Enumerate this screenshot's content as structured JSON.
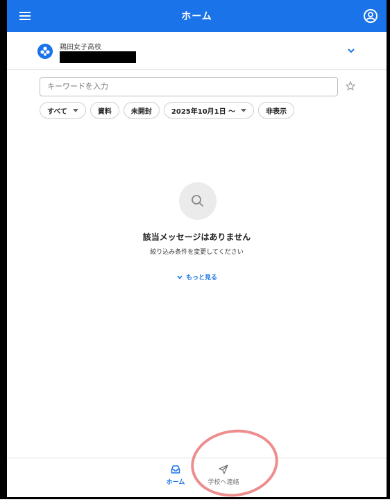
{
  "header": {
    "title": "ホーム"
  },
  "school": {
    "name": "鶏田女子高校"
  },
  "search": {
    "placeholder": "キーワードを入力"
  },
  "filters": [
    {
      "label": "すべて",
      "dropdown": true
    },
    {
      "label": "資料",
      "dropdown": false
    },
    {
      "label": "未開封",
      "dropdown": false
    },
    {
      "label": "2025年10月1日 〜",
      "dropdown": true
    },
    {
      "label": "非表示",
      "dropdown": false
    }
  ],
  "empty": {
    "title": "該当メッセージはありません",
    "subtitle": "絞り込み条件を変更してください",
    "more_label": "もっと見る"
  },
  "bottom_nav": {
    "home_label": "ホーム",
    "contact_label": "学校へ連絡"
  },
  "colors": {
    "primary": "#1a73e8",
    "annotation": "#ee8d8d"
  },
  "icons": [
    "menu-icon",
    "account-icon",
    "school-logo-icon",
    "chevron-down-icon",
    "star-icon",
    "search-icon",
    "inbox-icon",
    "send-icon"
  ]
}
